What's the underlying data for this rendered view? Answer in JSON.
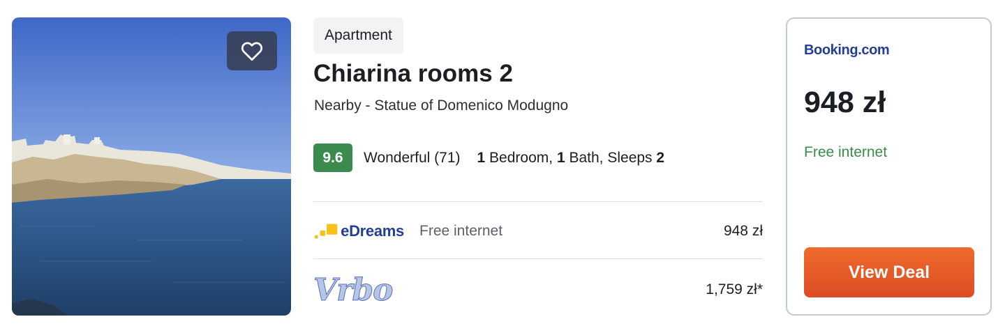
{
  "listing": {
    "type_badge": "Apartment",
    "title": "Chiarina rooms 2",
    "location": "Nearby - Statue of Domenico Modugno",
    "rating": {
      "score": "9.6",
      "label": "Wonderful (71)",
      "score_color": "#3b8a4e"
    },
    "specs": {
      "bedrooms": "1",
      "bedrooms_label": "Bedroom,",
      "baths": "1",
      "baths_label": "Bath, Sleeps",
      "sleeps": "2"
    }
  },
  "deals": [
    {
      "provider": "eDreams",
      "feature": "Free internet",
      "price": "948 zł",
      "logo_icon": "edreams-logo-icon"
    },
    {
      "provider": "Vrbo",
      "feature": "",
      "price": "1,759 zł*",
      "logo_icon": "vrbo-logo-icon"
    }
  ],
  "featured_deal": {
    "provider": "Booking.com",
    "price": "948 zł",
    "feature": "Free internet",
    "cta_label": "View Deal",
    "cta_color": "#e5582a",
    "feature_color": "#3b8a4e"
  },
  "photo": {
    "icon": "coastal-town-photo",
    "favorite_icon": "heart-icon"
  }
}
